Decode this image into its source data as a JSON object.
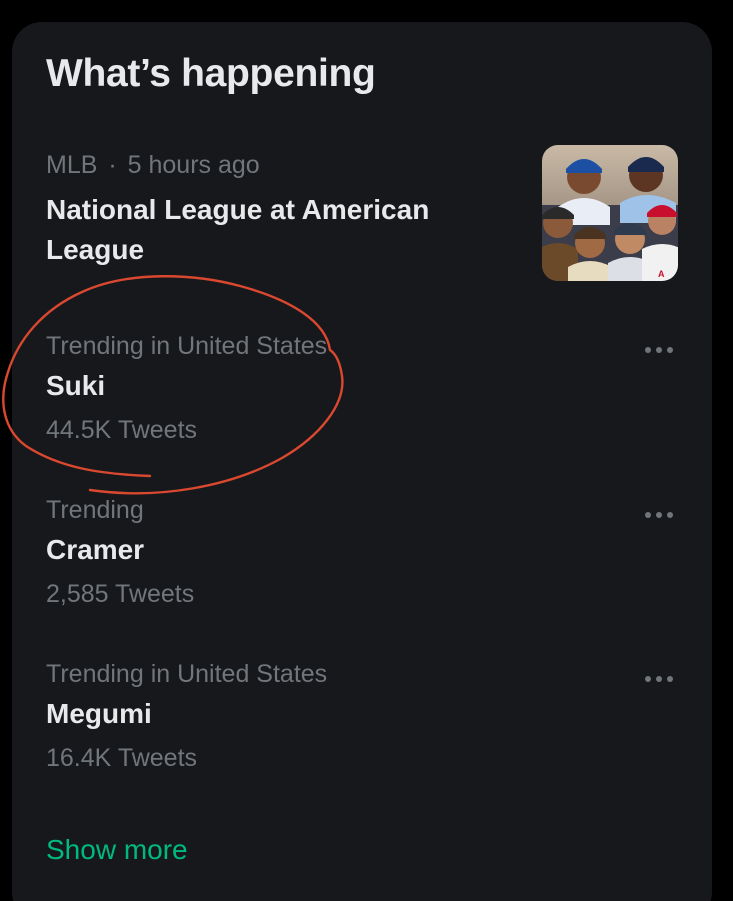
{
  "panel": {
    "heading": "What’s happening",
    "show_more": "Show more"
  },
  "featured": {
    "source": "MLB",
    "separator": "·",
    "time": "5 hours ago",
    "title": "National League at American League",
    "thumbnail_icon": "baseball-players-collage-image"
  },
  "trends": [
    {
      "context": "Trending in United States",
      "name": "Suki",
      "count": "44.5K Tweets"
    },
    {
      "context": "Trending",
      "name": "Cramer",
      "count": "2,585 Tweets"
    },
    {
      "context": "Trending in United States",
      "name": "Megumi",
      "count": "16.4K Tweets"
    }
  ],
  "colors": {
    "background": "#000000",
    "panel": "#16181c",
    "primary_text": "#e7e9ea",
    "secondary_text": "#71767b",
    "accent": "#00ba7c",
    "annotation": "#d9482f"
  },
  "icons": {
    "more": "more-horizontal-icon"
  }
}
